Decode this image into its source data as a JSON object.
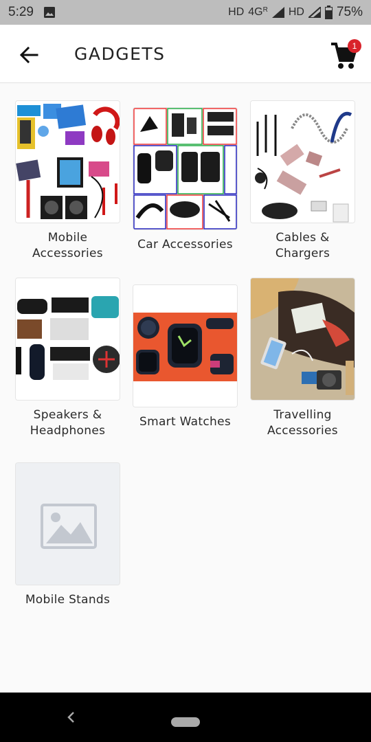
{
  "status_bar": {
    "time": "5:29",
    "network_left": "HD",
    "network_type": "4G",
    "roaming": "R",
    "network_right": "HD",
    "battery": "75%",
    "icons": [
      "gallery-icon",
      "signal-icon",
      "signal-icon",
      "battery-icon"
    ]
  },
  "app_bar": {
    "title": "GADGETS",
    "cart_count": "1",
    "accent_color": "#d9232b",
    "icons": [
      "arrow-left-icon",
      "shopping-cart-icon"
    ]
  },
  "categories": [
    {
      "label_line1": "Mobile",
      "label_line2": "Accessories"
    },
    {
      "label_line1": "Car Accessories",
      "label_line2": ""
    },
    {
      "label_line1": "Cables &",
      "label_line2": "Chargers"
    },
    {
      "label_line1": "Speakers &",
      "label_line2": "Headphones"
    },
    {
      "label_line1": "Smart Watches",
      "label_line2": ""
    },
    {
      "label_line1": "Travelling",
      "label_line2": "Accessories"
    },
    {
      "label_line1": "Mobile Stands",
      "label_line2": ""
    }
  ],
  "nav_bar": {
    "icons": [
      "nav-back-icon",
      "home-pill"
    ]
  }
}
